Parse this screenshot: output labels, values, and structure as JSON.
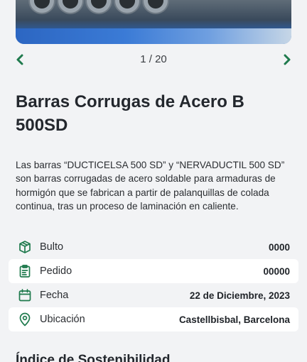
{
  "gallery": {
    "counter": "1 / 20"
  },
  "product": {
    "title": "Barras Corrugas de Acero B 500SD",
    "description": "Las barras “DUCTICELSA 500 SD” y “NERVADUCTIL 500 SD” son barras corrugadas de acero soldable para armaduras de hormigón que se fabrican a partir de palanquillas de colada continua, tras un proceso de laminación en caliente."
  },
  "details": [
    {
      "icon": "package-icon",
      "label": "Bulto",
      "value": "0000"
    },
    {
      "icon": "order-clipboard-icon",
      "label": "Pedido",
      "value": "00000"
    },
    {
      "icon": "calendar-icon",
      "label": "Fecha",
      "value": "22 de Diciembre, 2023"
    },
    {
      "icon": "location-pin-icon",
      "label": "Ubicación",
      "value": "Castellbisbal, Barcelona"
    }
  ],
  "sustainability": {
    "heading": "Índice de Sostenibilidad"
  },
  "colors": {
    "accent": "#1f7a4d",
    "background": "#f2f3f5"
  }
}
